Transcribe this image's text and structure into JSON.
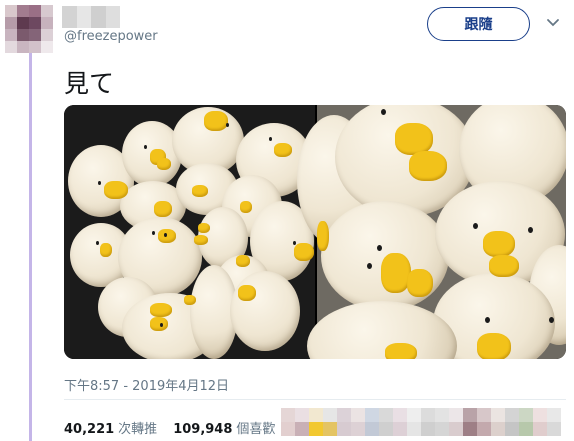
{
  "user": {
    "handle": "@freezepower"
  },
  "follow_button": {
    "label": "跟隨"
  },
  "tweet": {
    "text": "見て",
    "timestamp": "下午8:57 - 2019年4月12日",
    "retweets": {
      "count": "40,221",
      "label": "次轉推"
    },
    "likes": {
      "count": "109,948",
      "label": "個喜歡"
    }
  },
  "icons": {
    "menu": "chevron-down-icon"
  },
  "colors": {
    "accent": "#1a3f8a",
    "thread_line": "#c4b5e8",
    "muted_text": "#657786"
  }
}
